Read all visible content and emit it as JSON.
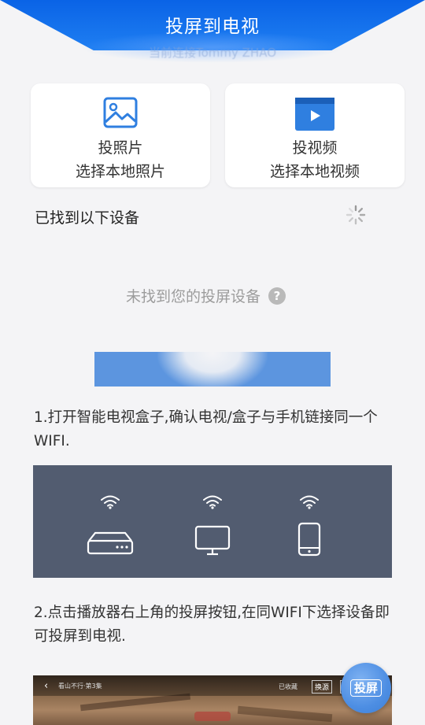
{
  "header": {
    "title": "投屏到电视",
    "subtitle": "当前连接Tommy ZHAO"
  },
  "cards": {
    "photo": {
      "title": "投照片",
      "subtitle": "选择本地照片",
      "icon": "image-icon"
    },
    "video": {
      "title": "投视频",
      "subtitle": "选择本地视频",
      "icon": "video-play-icon"
    }
  },
  "devices": {
    "found_label": "已找到以下设备",
    "not_found": "未找到您的投屏设备",
    "help_glyph": "?"
  },
  "steps": {
    "step1": "1.打开智能电视盒子,确认电视/盒子与手机链接同一个WIFI.",
    "step2": "2.点击播放器右上角的投屏按钮,在同WIFI下选择设备即可投屏到电视."
  },
  "player": {
    "back": "‹",
    "title": "看山不行·第3集",
    "action1": "已收藏",
    "action2": "换源",
    "action3": "投屏"
  },
  "fab": {
    "label": "投屏"
  },
  "colors": {
    "header_blue": "#0a63e6",
    "card_icon_blue": "#2f7fe0",
    "panel_gray": "#525c70",
    "button_blue": "#5c95df"
  }
}
